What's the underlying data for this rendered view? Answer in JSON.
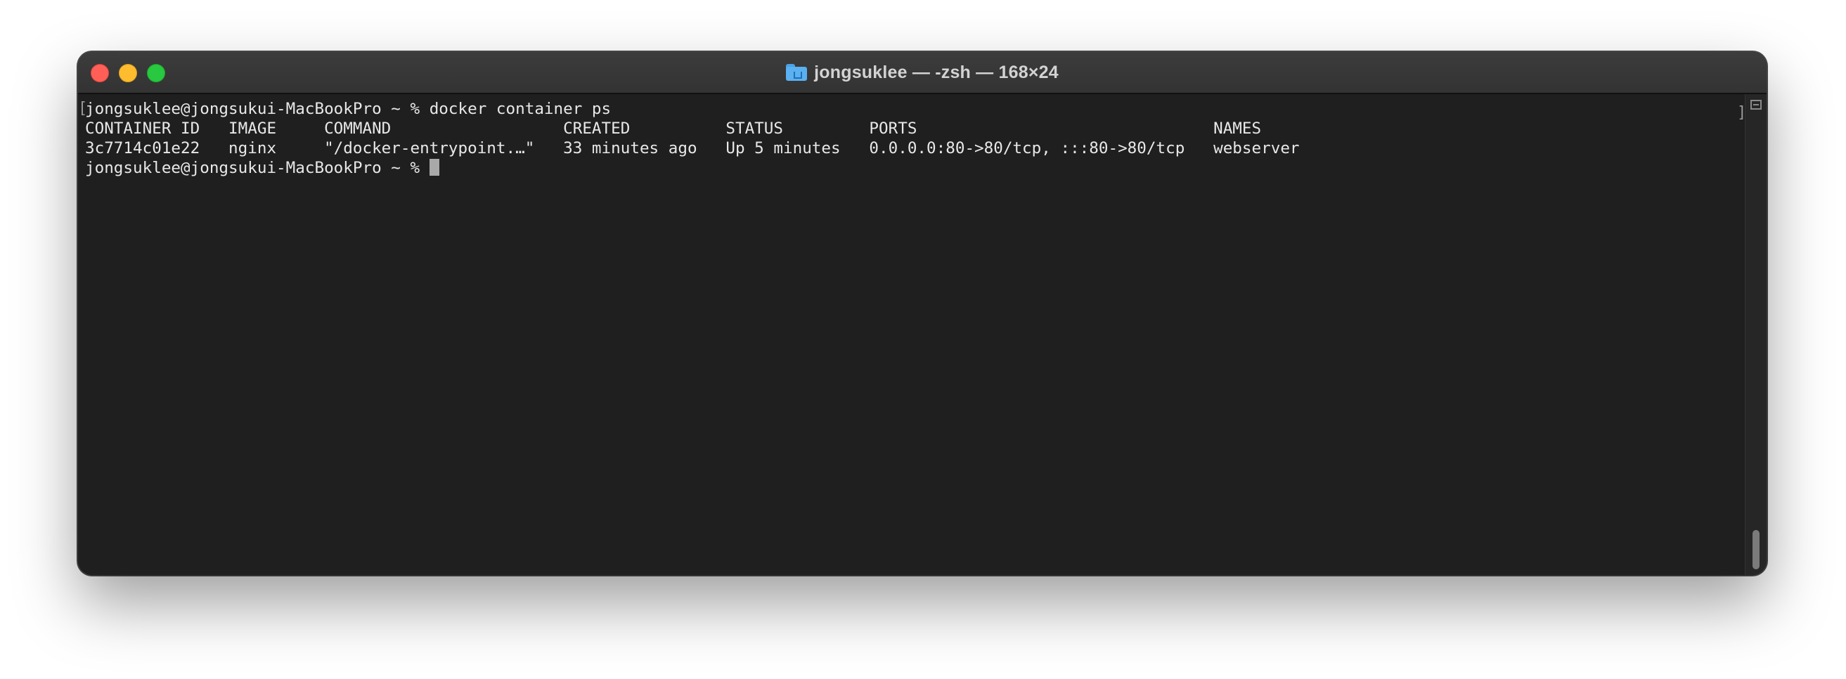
{
  "window": {
    "title": "jongsuklee — -zsh — 168×24",
    "icon": "home-folder-icon"
  },
  "terminal": {
    "lines": [
      "jongsuklee@jongsukui-MacBookPro ~ % docker container ps",
      "CONTAINER ID   IMAGE     COMMAND                  CREATED          STATUS         PORTS                               NAMES",
      "3c7714c01e22   nginx     \"/docker-entrypoint.…\"   33 minutes ago   Up 5 minutes   0.0.0.0:80->80/tcp, :::80->80/tcp   webserver",
      "jongsuklee@jongsukui-MacBookPro ~ % "
    ]
  },
  "colors": {
    "background": "#1f1f1f",
    "text": "#e8e8e8",
    "close": "#ff5f57",
    "minimize": "#febc2e",
    "maximize": "#28c840"
  }
}
